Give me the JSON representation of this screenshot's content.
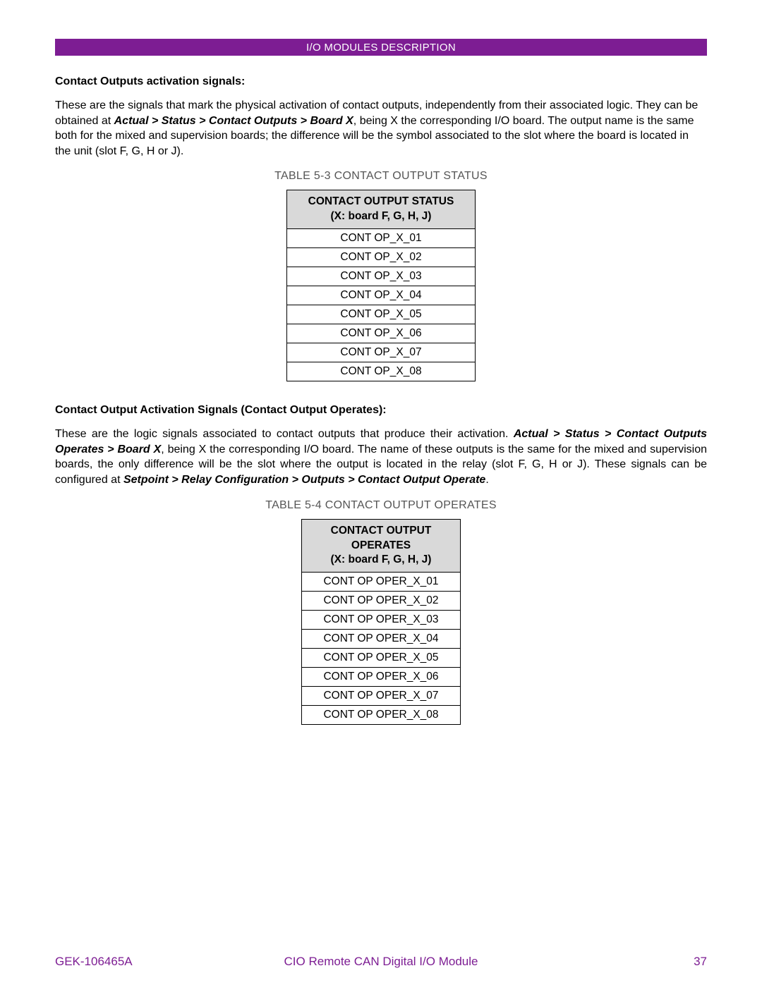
{
  "header": {
    "title": "I/O MODULES DESCRIPTION"
  },
  "section1": {
    "heading": "Contact Outputs activation signals:",
    "para_a": "These are the signals that mark the physical activation of contact outputs, independently from their associated logic. They can be obtained at ",
    "para_b_bold": "Actual > Status > Contact Outputs > Board X",
    "para_c": ", being X the corresponding I/O board. The output name is the same both for the mixed and supervision boards; the difference will be the symbol associated to the slot where the board is located in the unit  (slot F, G, H or J)."
  },
  "table1": {
    "caption": "TABLE  5-3 CONTACT OUTPUT STATUS",
    "header_line1": "CONTACT OUTPUT STATUS",
    "header_line2": "(X: board F, G, H, J)",
    "rows": [
      "CONT OP_X_01",
      "CONT OP_X_02",
      "CONT OP_X_03",
      "CONT OP_X_04",
      "CONT OP_X_05",
      "CONT OP_X_06",
      "CONT OP_X_07",
      "CONT OP_X_08"
    ]
  },
  "section2": {
    "heading": "Contact Output Activation Signals (Contact Output Operates):",
    "para_a": "These are the logic signals associated to contact outputs that produce their activation. ",
    "para_b_bold": "Actual > Status > Contact Outputs Operates > Board X",
    "para_c": ", being X the corresponding I/O board. The name of these outputs is the same for the mixed and supervision boards, the only difference will be the slot where the output is located in the relay (slot F, G, H or J). These signals can be configured at ",
    "para_d_bold": "Setpoint > Relay Configuration > Outputs > Contact Output Operate",
    "para_e": "."
  },
  "table2": {
    "caption": "TABLE  5-4 CONTACT OUTPUT OPERATES",
    "header_line1": "CONTACT OUTPUT",
    "header_line2": "OPERATES",
    "header_line3": "(X: board F, G, H, J)",
    "rows": [
      "CONT OP OPER_X_01",
      "CONT OP OPER_X_02",
      "CONT OP OPER_X_03",
      "CONT OP OPER_X_04",
      "CONT OP OPER_X_05",
      "CONT OP OPER_X_06",
      "CONT OP OPER_X_07",
      "CONT OP OPER_X_08"
    ]
  },
  "footer": {
    "left": "GEK-106465A",
    "center": "CIO Remote CAN Digital I/O Module",
    "right": "37"
  }
}
